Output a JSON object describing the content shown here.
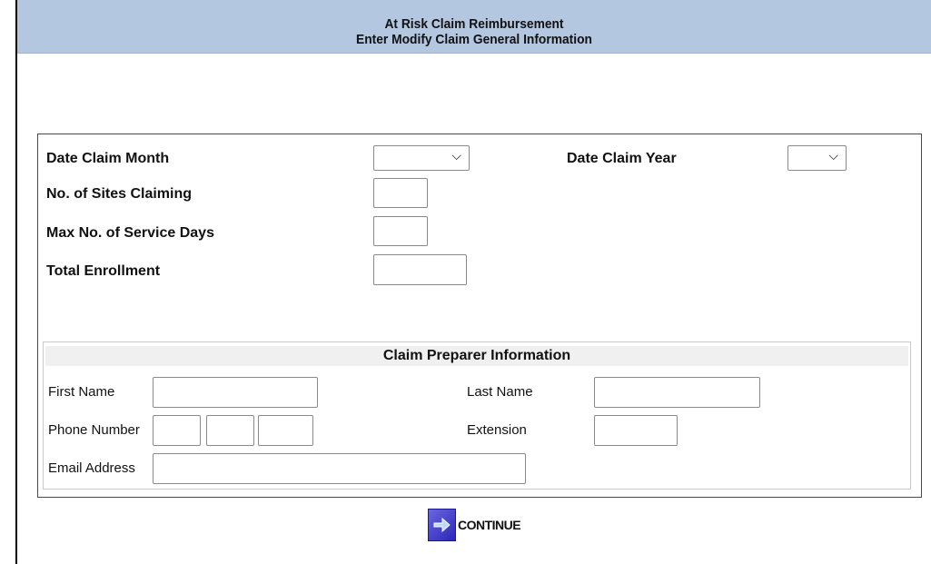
{
  "header": {
    "title": "At Risk Claim Reimbursement",
    "subtitle": "Enter Modify Claim General Information"
  },
  "claim": {
    "month_label": "Date Claim Month",
    "month_value": "",
    "year_label": "Date Claim Year",
    "year_value": "",
    "sites_label": "No. of Sites Claiming",
    "sites_value": "",
    "service_days_label": "Max No. of Service Days",
    "service_days_value": "",
    "enrollment_label": "Total Enrollment",
    "enrollment_value": ""
  },
  "preparer": {
    "title": "Claim Preparer Information",
    "first_name_label": "First Name",
    "last_name_label": "Last Name",
    "phone_label": "Phone Number",
    "extension_label": "Extension",
    "email_label": "Email Address"
  },
  "actions": {
    "continue_label": "CONTINUE"
  },
  "icons": {
    "select_chevron": "chevron-down-icon",
    "continue": "arrow-right-icon"
  }
}
